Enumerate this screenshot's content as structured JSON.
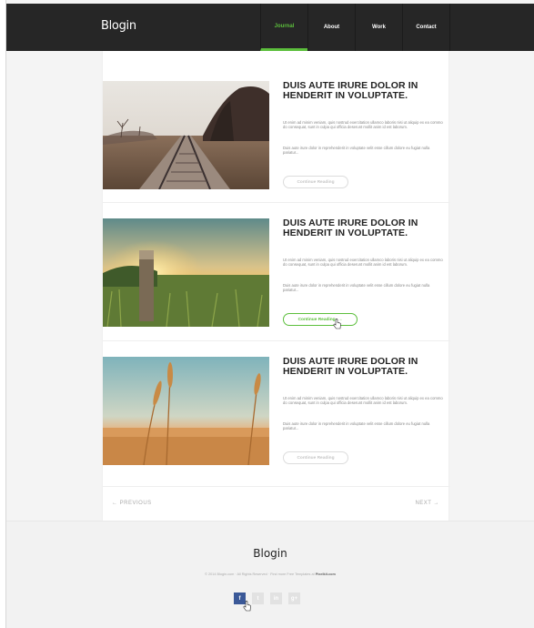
{
  "brand": {
    "logo": "Blogin"
  },
  "nav": {
    "items": [
      {
        "label": "Journal",
        "active": true
      },
      {
        "label": "About"
      },
      {
        "label": "Work"
      },
      {
        "label": "Contact"
      }
    ]
  },
  "posts": [
    {
      "title": "DUIS AUTE IRURE DOLOR IN HENDERIT IN VOLUPTATE.",
      "paragraph1": "Ut enim ad minim veniam, quis nostrud exercitation ullamco laboris nisi ut aliquip ex ea commo do consequat, sunt in culpa qui officia deserunt mollit anim id est laborum.",
      "paragraph2": "Duis aute irure dolor in reprehenderit in voluptate velit esse cillum dolore eu fugiat nulla pariatur...",
      "button": "Continue Reading",
      "image": "railroad-tracks"
    },
    {
      "title": "DUIS AUTE IRURE DOLOR IN HENDERIT IN VOLUPTATE.",
      "paragraph1": "Ut enim ad minim veniam, quis nostrud exercitation ullamco laboris nisi ut aliquip ex ea commo do consequat, sunt in culpa qui officia deserunt mollit anim id est laborum.",
      "paragraph2": "Duis aute irure dolor in reprehenderit in voluptate velit esse cillum dolore eu fugiat nulla pariatur...",
      "button": "Continue Reading",
      "button_arrow": "→",
      "image": "sunset-field-post"
    },
    {
      "title": "DUIS AUTE IRURE DOLOR IN HENDERIT IN VOLUPTATE.",
      "paragraph1": "Ut enim ad minim veniam, quis nostrud exercitation ullamco laboris nisi ut aliquip ex ea commo do consequat, sunt in culpa qui officia deserunt mollit anim id est laborum.",
      "paragraph2": "Duis aute irure dolor in reprehenderit in voluptate velit esse cillum dolore eu fugiat nulla pariatur...",
      "button": "Continue Reading",
      "image": "wheat-field"
    }
  ],
  "pagination": {
    "previous": "← PREVIOUS",
    "next": "NEXT →"
  },
  "footer": {
    "logo": "Blogin",
    "copyright": "© 2014 Blogin.com · All Rights Reserved · Find more Free Templates at",
    "copyright_link": "Pixelkit.com",
    "socials": [
      {
        "icon": "facebook-icon",
        "glyph": "f"
      },
      {
        "icon": "twitter-icon",
        "glyph": "t"
      },
      {
        "icon": "linkedin-icon",
        "glyph": "in"
      },
      {
        "icon": "google-plus-icon",
        "glyph": "g+"
      }
    ]
  },
  "colors": {
    "accent": "#5cbf3c",
    "header": "#262626",
    "facebook": "#3b5998"
  }
}
